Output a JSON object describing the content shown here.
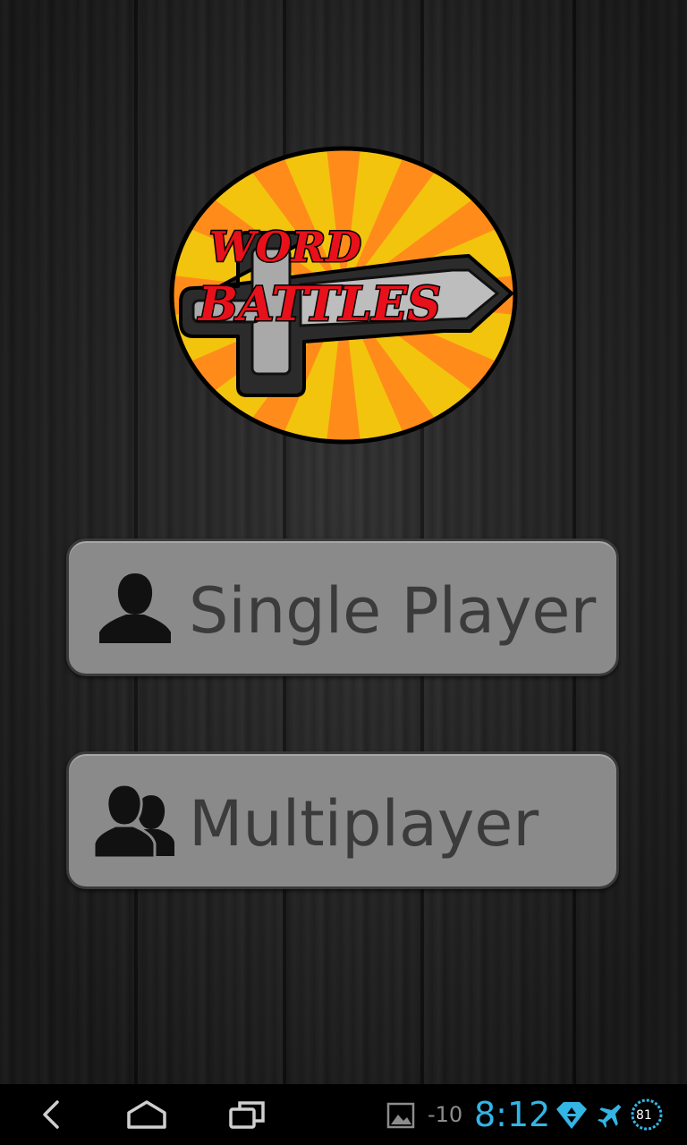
{
  "app": {
    "logo": {
      "line1": "WORD",
      "line2": "BATTLES"
    },
    "menu": {
      "single_player_label": "Single Player",
      "multiplayer_label": "Multiplayer"
    }
  },
  "system_bar": {
    "nav": {
      "back_icon": "back-arrow-icon",
      "home_icon": "home-icon",
      "recents_icon": "recent-apps-icon"
    },
    "status": {
      "gallery_icon": "image-notification-icon",
      "temperature": "-10",
      "time": "8:12",
      "network_icon": "data-signal-icon",
      "airplane_icon": "airplane-mode-icon",
      "battery": "81"
    }
  },
  "colors": {
    "button_fill": "#8a8a8a",
    "button_text": "#3b3b3b",
    "status_accent": "#33b5e5",
    "logo_yellow": "#f2c40d",
    "logo_orange": "#ff8c1a",
    "logo_red": "#e8101a"
  }
}
